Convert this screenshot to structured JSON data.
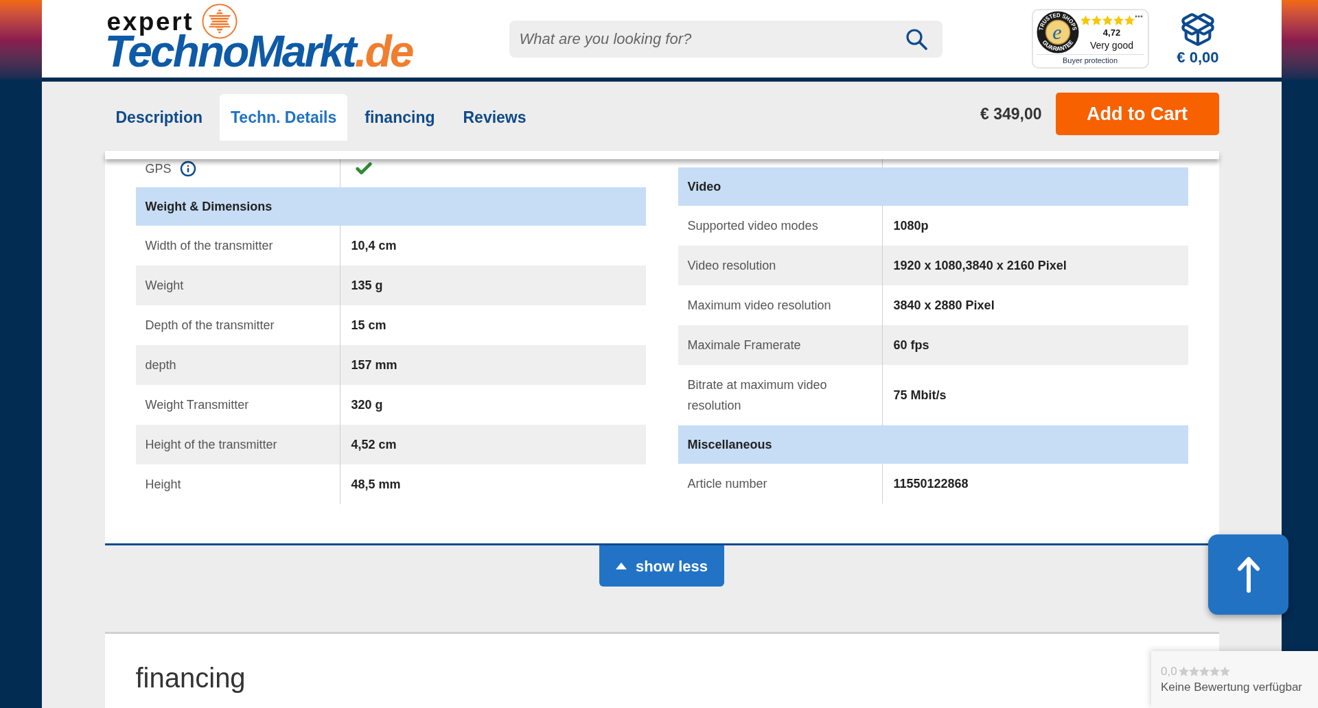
{
  "header": {
    "logo": {
      "brand_top": "expert",
      "brand_main": "TechnoMarkt",
      "brand_suffix": ".de"
    },
    "search": {
      "placeholder": "What are you looking for?"
    },
    "trust_badge": {
      "seal_top": "TRUSTED SHOPS",
      "seal_letter": "e",
      "seal_bottom": "GUARANTEE",
      "stars": 5,
      "rating": "4,72",
      "verdict": "Very good",
      "note": "Buyer protection"
    },
    "cart": {
      "total": "€ 0,00"
    }
  },
  "tabs": [
    {
      "label": "Description",
      "selected": false
    },
    {
      "label": "Techn. Details",
      "selected": true
    },
    {
      "label": "financing",
      "selected": false
    },
    {
      "label": "Reviews",
      "selected": false
    }
  ],
  "buy_bar": {
    "price": "€ 349,00",
    "button": "Add to Cart"
  },
  "spec_tables": [
    {
      "rows": [
        {
          "kind": "check",
          "label": "GPS",
          "info": true
        },
        {
          "kind": "section",
          "label": "Weight & Dimensions"
        },
        {
          "kind": "text",
          "label": "Width of the transmitter",
          "value": "10,4 cm",
          "info": false
        },
        {
          "kind": "text",
          "label": "Weight",
          "value": "135 g",
          "info": false
        },
        {
          "kind": "text",
          "label": "Depth of the transmitter",
          "value": "15 cm",
          "info": false
        },
        {
          "kind": "text",
          "label": "depth",
          "value": "157 mm",
          "info": false
        },
        {
          "kind": "text",
          "label": "Weight Transmitter",
          "value": "320 g",
          "info": false
        },
        {
          "kind": "text",
          "label": "Height of the transmitter",
          "value": "4,52 cm",
          "info": false
        },
        {
          "kind": "text",
          "label": "Height",
          "value": "48,5 mm",
          "info": false
        }
      ]
    },
    {
      "rows": [
        {
          "kind": "section",
          "label": "Video"
        },
        {
          "kind": "text",
          "label": "Supported video modes",
          "value": "1080p",
          "info": false
        },
        {
          "kind": "text",
          "label": "Video resolution",
          "value": "1920 x 1080,3840 x 2160 Pixel",
          "info": false
        },
        {
          "kind": "text",
          "label": "Maximum video resolution",
          "value": "3840 x 2880 Pixel",
          "info": false
        },
        {
          "kind": "text",
          "label": "Maximale Framerate",
          "value": "60 fps",
          "info": false
        },
        {
          "kind": "text",
          "label": "Bitrate at maximum video resolution",
          "value": "75 Mbit/s",
          "info": false
        },
        {
          "kind": "section",
          "label": "Miscellaneous"
        },
        {
          "kind": "text",
          "label": "Article number",
          "value": "11550122868",
          "info": false
        }
      ]
    }
  ],
  "show_less": {
    "label": "show less"
  },
  "financing": {
    "title": "financing"
  },
  "rating_widget": {
    "score": "0,0",
    "stars": 0,
    "text": "Keine Bewertung verfügbar"
  }
}
